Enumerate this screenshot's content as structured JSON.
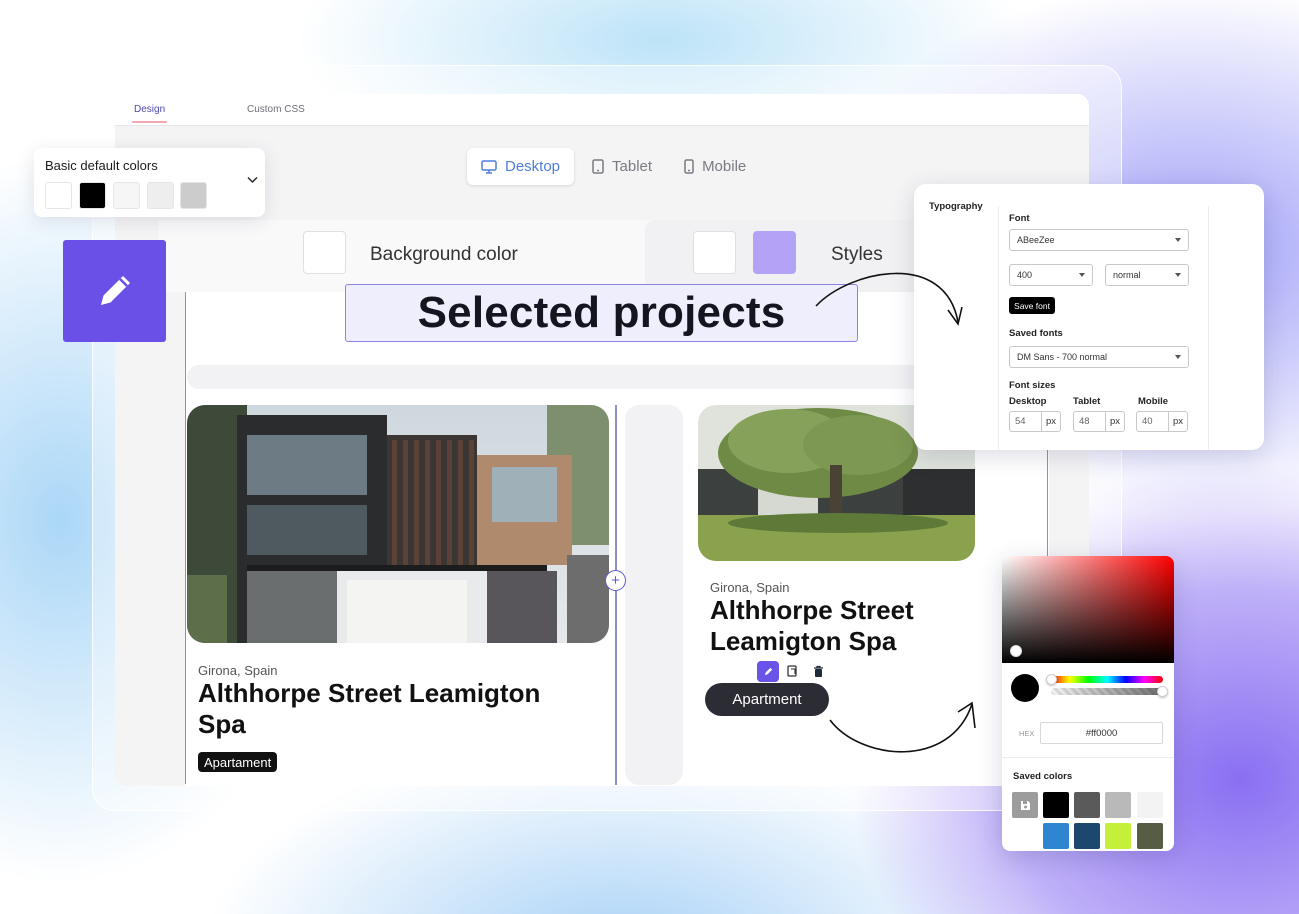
{
  "tabs": {
    "design": "Design",
    "custom_css": "Custom CSS"
  },
  "devices": [
    {
      "label": "Desktop",
      "icon": "desktop-icon",
      "active": true
    },
    {
      "label": "Tablet",
      "icon": "tablet-icon",
      "active": false
    },
    {
      "label": "Mobile",
      "icon": "mobile-icon",
      "active": false
    }
  ],
  "color_bar": {
    "background_label": "Background color",
    "styles_label": "Styles",
    "styles_swatch": "#b3a2f5"
  },
  "basic_colors": {
    "title": "Basic default colors",
    "swatches": [
      "#ffffff",
      "#000000",
      "#f6f6f6",
      "#eeeeee",
      "#cccccc"
    ]
  },
  "heading": {
    "text": "Selected projects"
  },
  "projects": [
    {
      "location": "Girona, Spain",
      "title_line1": "Althhorpe Street Leamigton",
      "title_line2": "Spa",
      "tag": "Apartament"
    },
    {
      "location": "Girona, Spain",
      "title_line1": "Althhorpe Street",
      "title_line2": "Leamigton Spa",
      "tag": "Apartment"
    }
  ],
  "typography": {
    "section": "Typography",
    "font_label": "Font",
    "font_value": "ABeeZee",
    "weight_value": "400",
    "style_value": "normal",
    "save_font_label": "Save font",
    "saved_fonts_label": "Saved fonts",
    "saved_font_value": "DM Sans - 700 normal",
    "font_sizes_label": "Font sizes",
    "sizes": [
      {
        "label": "Desktop",
        "value": "54",
        "unit": "px"
      },
      {
        "label": "Tablet",
        "value": "48",
        "unit": "px"
      },
      {
        "label": "Mobile",
        "value": "40",
        "unit": "px"
      }
    ]
  },
  "picker": {
    "hex_label": "HEX",
    "hex_value": "#ff0000",
    "saved_colors_label": "Saved colors",
    "hue_fraction": 0.0,
    "alpha_fraction": 1.0,
    "saved_colors": [
      "#000000",
      "#5a5a5a",
      "#b9b9b9",
      "#f3f3f3",
      "#2e86d0",
      "#1c4870",
      "#c4f03a",
      "#575c44"
    ]
  },
  "accent": "#6b50e8"
}
